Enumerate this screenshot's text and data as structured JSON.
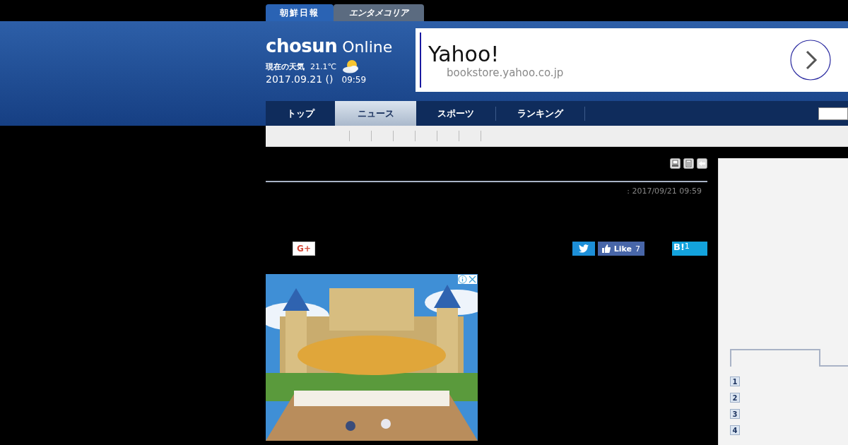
{
  "edition_tabs": [
    {
      "label": "朝鮮日報",
      "selected": true
    },
    {
      "label": "エンタメコリア",
      "selected": false
    }
  ],
  "logo": {
    "brand": "chosun",
    "suffix": "Online"
  },
  "weather": {
    "label": "現在の天気",
    "temperature": "21.1℃"
  },
  "date": {
    "date": "2017.09.21 ()",
    "time": "09:59"
  },
  "ad": {
    "title": "Yahoo!",
    "url": "bookstore.yahoo.co.jp"
  },
  "nav": [
    {
      "label": "トップ",
      "selected": false
    },
    {
      "label": "ニュース",
      "selected": true
    },
    {
      "label": "スポーツ",
      "selected": false
    },
    {
      "label": "ランキング",
      "selected": false
    }
  ],
  "article": {
    "timestamp": ": 2017/09/21 09:59"
  },
  "share": {
    "googleplus_label": "G+",
    "facebook_label": "Like",
    "facebook_count": "7",
    "hatena_label": "B!",
    "hatena_count": "1"
  },
  "ranking": [
    "1",
    "2",
    "3",
    "4"
  ]
}
